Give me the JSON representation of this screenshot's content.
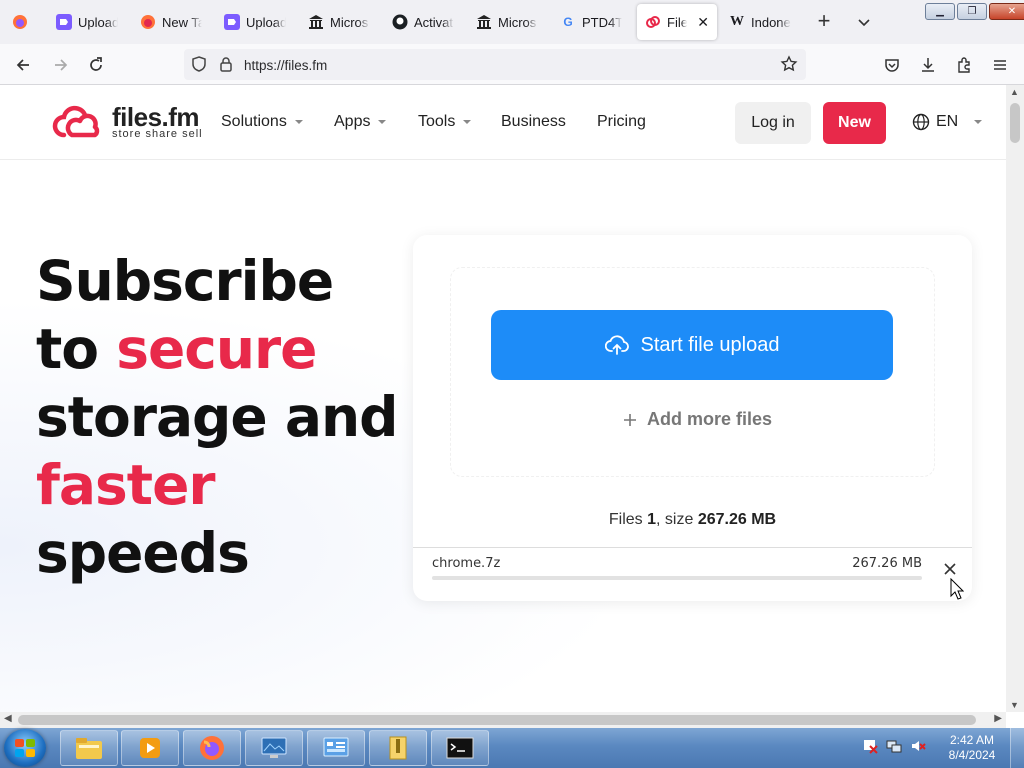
{
  "browser": {
    "tabs": [
      {
        "label": "Upload",
        "icon": "proton-icon"
      },
      {
        "label": "New Ta",
        "icon": "firefox-icon"
      },
      {
        "label": "Upload",
        "icon": "proton-icon"
      },
      {
        "label": "Micros",
        "icon": "museum-icon"
      },
      {
        "label": "Activat",
        "icon": "github-icon"
      },
      {
        "label": "Micros",
        "icon": "museum-icon"
      },
      {
        "label": "PTD4T",
        "icon": "google-icon"
      },
      {
        "label": "File",
        "icon": "filesfm-icon",
        "active": true
      },
      {
        "label": "Indones",
        "icon": "wikipedia-icon"
      }
    ],
    "url": "https://files.fm"
  },
  "site": {
    "logo_name": "files.fm",
    "logo_tagline": "store  share  sell",
    "nav": {
      "solutions": "Solutions",
      "apps": "Apps",
      "tools": "Tools",
      "business": "Business",
      "pricing": "Pricing"
    },
    "login_label": "Log in",
    "new_label": "New",
    "language": "EN"
  },
  "hero": {
    "line1": "Subscribe",
    "line2_a": "to ",
    "line2_b": "secure",
    "line3": "storage and",
    "line4": "faster",
    "line5": "speeds"
  },
  "upload": {
    "start_label": "Start file upload",
    "add_more_label": "Add more files",
    "summary_files_label": "Files ",
    "summary_files_count": "1",
    "summary_size_label": ", size ",
    "summary_size_value": "267.26 MB",
    "file": {
      "name": "chrome.7z",
      "size": "267.26 MB",
      "progress": 0
    }
  },
  "taskbar": {
    "time": "2:42 AM",
    "date": "8/4/2024"
  },
  "colors": {
    "brand_red": "#e8294a",
    "upload_blue": "#1d8cf8"
  }
}
